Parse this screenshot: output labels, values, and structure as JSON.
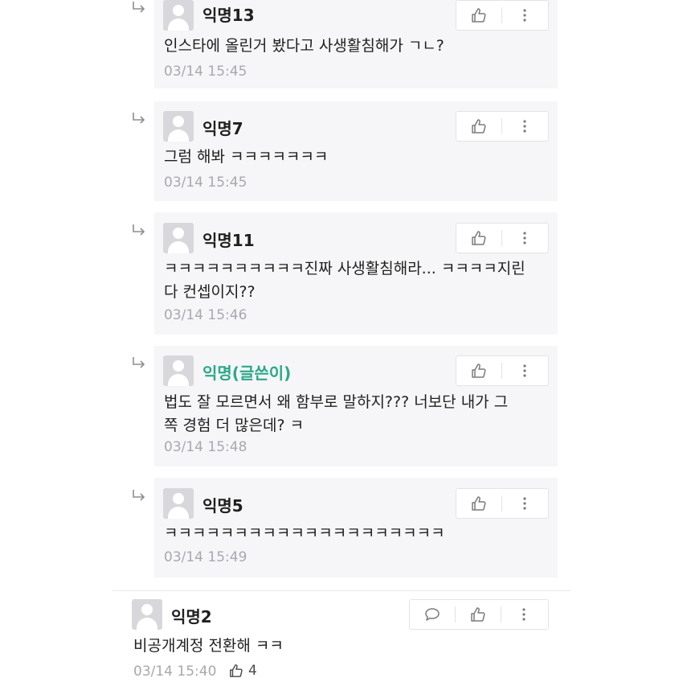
{
  "comments": [
    {
      "nickname": "익명13",
      "text": "인스타에 올린거 봤다고 사생활침해가 ㄱㄴ?",
      "time": "03/14 15:45"
    },
    {
      "nickname": "익명7",
      "text": "그럼 해봐 ㅋㅋㅋㅋㅋㅋㅋ",
      "time": "03/14 15:45"
    },
    {
      "nickname": "익명11",
      "text_line1": "ㅋㅋㅋㅋㅋㅋㅋㅋㅋㅋ진짜 사생활침해라... ㅋㅋㅋㅋ지린",
      "text_line2": "다 컨셉이지??",
      "time": "03/14 15:46"
    },
    {
      "nickname": "익명(글쓴이)",
      "text_line1": "법도 잘 모르면서 왜 함부로 말하지??? 너보단 내가 그",
      "text_line2": "쪽 경험 더 많은데? ㅋ",
      "time": "03/14 15:48"
    },
    {
      "nickname": "익명5",
      "text": "ㅋㅋㅋㅋㅋㅋㅋㅋㅋㅋㅋㅋㅋㅋㅋㅋㅋㅋㅋㅋ",
      "time": "03/14 15:49"
    }
  ],
  "main_comment": {
    "nickname": "익명2",
    "text": "비공개계정 전환해 ㅋㅋ",
    "time": "03/14 15:40",
    "like_count": "4"
  },
  "icons": {
    "reply_arrow": "reply-arrow-icon",
    "like": "thumbs-up-icon",
    "more": "more-vertical-icon",
    "comment": "speech-bubble-icon",
    "avatar": "default-avatar-icon"
  },
  "colors": {
    "writer_nickname": "#2ba88a",
    "reply_background": "#f6f6f8",
    "time_text": "#a8a8ae"
  }
}
